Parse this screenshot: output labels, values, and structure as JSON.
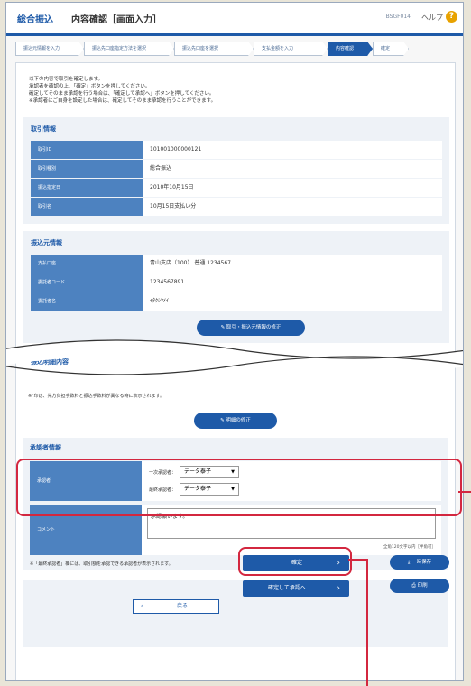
{
  "header": {
    "category": "総合振込",
    "title": "内容確認［画面入力］",
    "screen_code": "BSGF014",
    "help_label": "ヘルプ",
    "help_icon": "?"
  },
  "steps": [
    {
      "label": "振込元情報を入力"
    },
    {
      "label": "振込先口座指定方法を選択"
    },
    {
      "label": "振込先口座を選択"
    },
    {
      "label": "支払金額を入力"
    },
    {
      "label": "内容確認"
    },
    {
      "label": "確定"
    }
  ],
  "intro": {
    "line1": "以下の内容で取引を確定します。",
    "line2": "承認者を確認の上、「確定」ボタンを押してください。",
    "line3": "確定してそのまま承認を行う場合は、「確定して承認へ」ボタンを押してください。",
    "line4": "※承認者にご自身を設定した場合は、確定してそのまま承認を行うことができます。"
  },
  "transaction": {
    "title": "取引情報",
    "rows": [
      {
        "key": "取引ID",
        "value": "101001000000121"
      },
      {
        "key": "取引種別",
        "value": "総合振込"
      },
      {
        "key": "振込指定日",
        "value": "2010年10月15日"
      },
      {
        "key": "取引名",
        "value": "10月15日支払い分"
      }
    ]
  },
  "source": {
    "title": "振込元情報",
    "rows": [
      {
        "key": "支払口座",
        "value": "青山支店（100） 普通 1234567"
      },
      {
        "key": "委託者コード",
        "value": "1234567891"
      },
      {
        "key": "委託者名",
        "value": "ｲﾀｸｼﾔﾒｲ"
      }
    ],
    "edit_button": "取引・振込元情報の修正"
  },
  "details": {
    "title": "振込明細内容",
    "note": "※\"印は、先方負担手数料と振込手数料が異なる時に表示されます。",
    "edit_button": "明細の修正"
  },
  "approver": {
    "title": "承認者情報",
    "key_approver": "承認者",
    "first_label": "一次承認者：",
    "first_value": "データ泰子",
    "final_label": "最終承認者：",
    "final_value": "データ泰子",
    "key_comment": "コメント",
    "comment_value": "承認願います。",
    "char_hint": "全角120文字以内［半角可］",
    "footnote": "※「最終承認者」欄には、取引額を承認できる承認者が表示されます。"
  },
  "actions": {
    "back": "戻る",
    "confirm": "確定",
    "confirm_approve": "確定して承認へ",
    "save": "一時保存",
    "print": "印刷"
  },
  "colors": {
    "brand_blue": "#1e5aa8",
    "highlight_red": "#d3273f"
  }
}
